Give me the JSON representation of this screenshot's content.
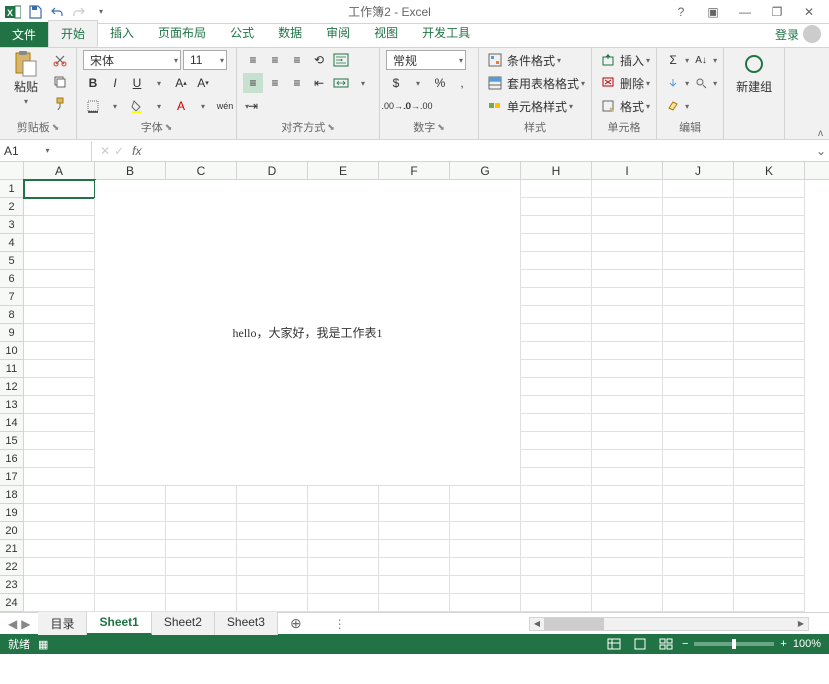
{
  "title": "工作簿2 - Excel",
  "login": "登录",
  "tabs": {
    "file": "文件",
    "items": [
      "开始",
      "插入",
      "页面布局",
      "公式",
      "数据",
      "审阅",
      "视图",
      "开发工具"
    ],
    "active_index": 0
  },
  "ribbon": {
    "clipboard": {
      "paste": "粘贴",
      "label": "剪贴板"
    },
    "font": {
      "name": "宋体",
      "size": "11",
      "bold": "B",
      "italic": "I",
      "underline": "U",
      "pinyin": "wén",
      "label": "字体"
    },
    "align": {
      "label": "对齐方式"
    },
    "number": {
      "format": "常规",
      "label": "数字"
    },
    "styles": {
      "conditional": "条件格式",
      "table": "套用表格格式",
      "cell": "单元格样式",
      "label": "样式"
    },
    "cells_grp": {
      "insert": "插入",
      "delete": "删除",
      "format": "格式",
      "label": "单元格"
    },
    "editing": {
      "label": "编辑"
    },
    "newgroup": {
      "label": "新建组"
    }
  },
  "name_box": "A1",
  "fx": "fx",
  "columns": [
    "A",
    "B",
    "C",
    "D",
    "E",
    "F",
    "G",
    "H",
    "I",
    "J",
    "K"
  ],
  "row_count": 24,
  "merged_text": "hello，大家好，我是工作表1",
  "sheet_tabs": [
    "目录",
    "Sheet1",
    "Sheet2",
    "Sheet3"
  ],
  "active_sheet_index": 1,
  "status": {
    "ready": "就绪",
    "rec": "▦",
    "zoom": "100%"
  }
}
